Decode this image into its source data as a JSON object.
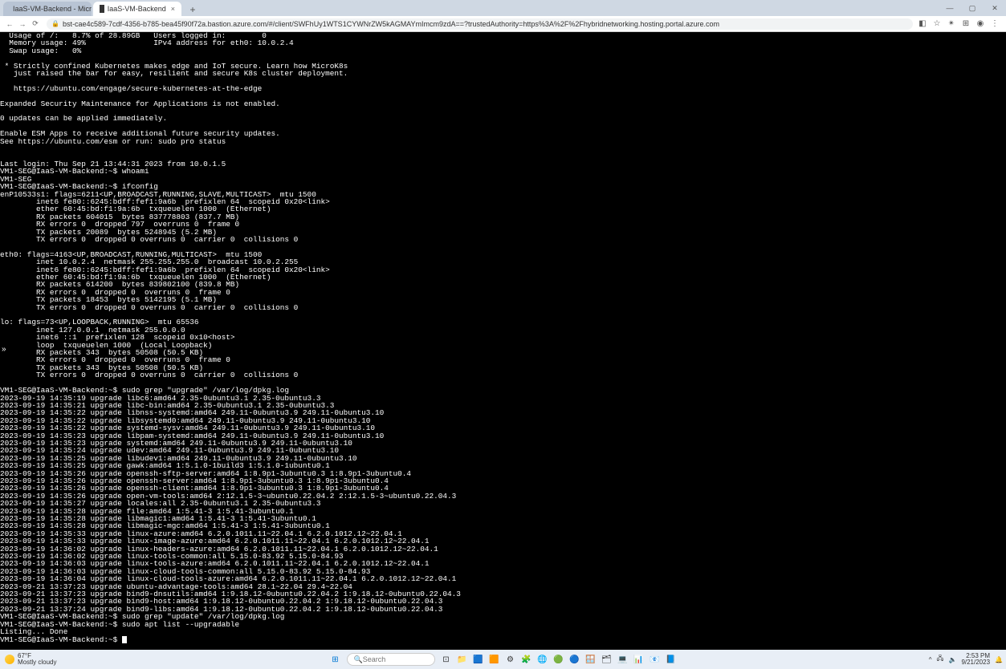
{
  "browser": {
    "tabs": [
      {
        "title": "IaaS-VM-Backend - Microsoft A",
        "active": false
      },
      {
        "title": "IaaS-VM-Backend",
        "active": true
      }
    ],
    "newtab_glyph": "+",
    "win": {
      "min": "—",
      "max": "▢",
      "close": "✕"
    },
    "nav": {
      "back": "←",
      "forward": "→",
      "reload": "⟳"
    },
    "lock_glyph": "🔒",
    "url": "bst-cae4c589-7cdf-4356-b785-bea45f90f72a.bastion.azure.com/#/client/SWFhUy1WTS1CYWNrZW5kAGMAYmImcm9zdA==?trustedAuthority=https%3A%2F%2Fhybridnetworking.hosting.portal.azure.com",
    "ext": {
      "sq": "◧",
      "star": "☆",
      "puzzle": "✴",
      "ab": "⊞",
      "dots": "⋮",
      "avatar": "◉"
    }
  },
  "terminal": {
    "expand_glyph": "»",
    "prompt": "VM1-SEG@IaaS-VM-Backend:~$ ",
    "lines": [
      "  Usage of /:   8.7% of 28.89GB   Users logged in:        0",
      "  Memory usage: 49%               IPv4 address for eth0: 10.0.2.4",
      "  Swap usage:   0%",
      "",
      " * Strictly confined Kubernetes makes edge and IoT secure. Learn how MicroK8s",
      "   just raised the bar for easy, resilient and secure K8s cluster deployment.",
      "",
      "   https://ubuntu.com/engage/secure-kubernetes-at-the-edge",
      "",
      "Expanded Security Maintenance for Applications is not enabled.",
      "",
      "0 updates can be applied immediately.",
      "",
      "Enable ESM Apps to receive additional future security updates.",
      "See https://ubuntu.com/esm or run: sudo pro status",
      "",
      "",
      "Last login: Thu Sep 21 13:44:31 2023 from 10.0.1.5",
      "VM1-SEG@IaaS-VM-Backend:~$ whoami",
      "VM1-SEG",
      "VM1-SEG@IaaS-VM-Backend:~$ ifconfig",
      "enP10533s1: flags=6211<UP,BROADCAST,RUNNING,SLAVE,MULTICAST>  mtu 1500",
      "        inet6 fe80::6245:bdff:fef1:9a6b  prefixlen 64  scopeid 0x20<link>",
      "        ether 60:45:bd:f1:9a:6b  txqueuelen 1000  (Ethernet)",
      "        RX packets 604015  bytes 837778803 (837.7 MB)",
      "        RX errors 0  dropped 797  overruns 0  frame 0",
      "        TX packets 20089  bytes 5248945 (5.2 MB)",
      "        TX errors 0  dropped 0 overruns 0  carrier 0  collisions 0",
      "",
      "eth0: flags=4163<UP,BROADCAST,RUNNING,MULTICAST>  mtu 1500",
      "        inet 10.0.2.4  netmask 255.255.255.0  broadcast 10.0.2.255",
      "        inet6 fe80::6245:bdff:fef1:9a6b  prefixlen 64  scopeid 0x20<link>",
      "        ether 60:45:bd:f1:9a:6b  txqueuelen 1000  (Ethernet)",
      "        RX packets 614200  bytes 839802100 (839.8 MB)",
      "        RX errors 0  dropped 0  overruns 0  frame 0",
      "        TX packets 18453  bytes 5142195 (5.1 MB)",
      "        TX errors 0  dropped 0 overruns 0  carrier 0  collisions 0",
      "",
      "lo: flags=73<UP,LOOPBACK,RUNNING>  mtu 65536",
      "        inet 127.0.0.1  netmask 255.0.0.0",
      "        inet6 ::1  prefixlen 128  scopeid 0x10<host>",
      "        loop  txqueuelen 1000  (Local Loopback)",
      "        RX packets 343  bytes 50508 (50.5 KB)",
      "        RX errors 0  dropped 0  overruns 0  frame 0",
      "        TX packets 343  bytes 50508 (50.5 KB)",
      "        TX errors 0  dropped 0 overruns 0  carrier 0  collisions 0",
      "",
      "VM1-SEG@IaaS-VM-Backend:~$ sudo grep \"upgrade\" /var/log/dpkg.log",
      "2023-09-19 14:35:19 upgrade libc6:amd64 2.35-0ubuntu3.1 2.35-0ubuntu3.3",
      "2023-09-19 14:35:21 upgrade libc-bin:amd64 2.35-0ubuntu3.1 2.35-0ubuntu3.3",
      "2023-09-19 14:35:22 upgrade libnss-systemd:amd64 249.11-0ubuntu3.9 249.11-0ubuntu3.10",
      "2023-09-19 14:35:22 upgrade libsystemd0:amd64 249.11-0ubuntu3.9 249.11-0ubuntu3.10",
      "2023-09-19 14:35:22 upgrade systemd-sysv:amd64 249.11-0ubuntu3.9 249.11-0ubuntu3.10",
      "2023-09-19 14:35:23 upgrade libpam-systemd:amd64 249.11-0ubuntu3.9 249.11-0ubuntu3.10",
      "2023-09-19 14:35:23 upgrade systemd:amd64 249.11-0ubuntu3.9 249.11-0ubuntu3.10",
      "2023-09-19 14:35:24 upgrade udev:amd64 249.11-0ubuntu3.9 249.11-0ubuntu3.10",
      "2023-09-19 14:35:25 upgrade libudev1:amd64 249.11-0ubuntu3.9 249.11-0ubuntu3.10",
      "2023-09-19 14:35:25 upgrade gawk:amd64 1:5.1.0-1build3 1:5.1.0-1ubuntu0.1",
      "2023-09-19 14:35:26 upgrade openssh-sftp-server:amd64 1:8.9p1-3ubuntu0.3 1:8.9p1-3ubuntu0.4",
      "2023-09-19 14:35:26 upgrade openssh-server:amd64 1:8.9p1-3ubuntu0.3 1:8.9p1-3ubuntu0.4",
      "2023-09-19 14:35:26 upgrade openssh-client:amd64 1:8.9p1-3ubuntu0.3 1:8.9p1-3ubuntu0.4",
      "2023-09-19 14:35:26 upgrade open-vm-tools:amd64 2:12.1.5-3~ubuntu0.22.04.2 2:12.1.5-3~ubuntu0.22.04.3",
      "2023-09-19 14:35:27 upgrade locales:all 2.35-0ubuntu3.1 2.35-0ubuntu3.3",
      "2023-09-19 14:35:28 upgrade file:amd64 1:5.41-3 1:5.41-3ubuntu0.1",
      "2023-09-19 14:35:28 upgrade libmagic1:amd64 1:5.41-3 1:5.41-3ubuntu0.1",
      "2023-09-19 14:35:28 upgrade libmagic-mgc:amd64 1:5.41-3 1:5.41-3ubuntu0.1",
      "2023-09-19 14:35:33 upgrade linux-azure:amd64 6.2.0.1011.11~22.04.1 6.2.0.1012.12~22.04.1",
      "2023-09-19 14:35:33 upgrade linux-image-azure:amd64 6.2.0.1011.11~22.04.1 6.2.0.1012.12~22.04.1",
      "2023-09-19 14:36:02 upgrade linux-headers-azure:amd64 6.2.0.1011.11~22.04.1 6.2.0.1012.12~22.04.1",
      "2023-09-19 14:36:02 upgrade linux-tools-common:all 5.15.0-83.92 5.15.0-84.93",
      "2023-09-19 14:36:03 upgrade linux-tools-azure:amd64 6.2.0.1011.11~22.04.1 6.2.0.1012.12~22.04.1",
      "2023-09-19 14:36:03 upgrade linux-cloud-tools-common:all 5.15.0-83.92 5.15.0-84.93",
      "2023-09-19 14:36:04 upgrade linux-cloud-tools-azure:amd64 6.2.0.1011.11~22.04.1 6.2.0.1012.12~22.04.1",
      "2023-09-21 13:37:23 upgrade ubuntu-advantage-tools:amd64 28.1~22.04 29.4~22.04",
      "2023-09-21 13:37:23 upgrade bind9-dnsutils:amd64 1:9.18.12-0ubuntu0.22.04.2 1:9.18.12-0ubuntu0.22.04.3",
      "2023-09-21 13:37:23 upgrade bind9-host:amd64 1:9.18.12-0ubuntu0.22.04.2 1:9.18.12-0ubuntu0.22.04.3",
      "2023-09-21 13:37:24 upgrade bind9-libs:amd64 1:9.18.12-0ubuntu0.22.04.2 1:9.18.12-0ubuntu0.22.04.3",
      "VM1-SEG@IaaS-VM-Backend:~$ sudo grep \"update\" /var/log/dpkg.log",
      "VM1-SEG@IaaS-VM-Backend:~$ sudo apt list --upgradable",
      "Listing... Done"
    ]
  },
  "taskbar": {
    "weather": {
      "temp": "67°F",
      "desc": "Mostly cloudy"
    },
    "start_glyph": "⊞",
    "search_glyph": "🔍",
    "search_placeholder": "Search",
    "icons": [
      "⊡",
      "📁",
      "🟦",
      "🟧",
      "⚙",
      "🧩",
      "🌐",
      "🟢",
      "🔵",
      "🪟",
      "🗂",
      "💻",
      "📊",
      "📧",
      "📘"
    ],
    "tray": {
      "up": "^",
      "net": "🖧",
      "vol": "🔈",
      "time": "2:53 PM",
      "date": "9/21/2023",
      "bell": "🔔"
    }
  }
}
